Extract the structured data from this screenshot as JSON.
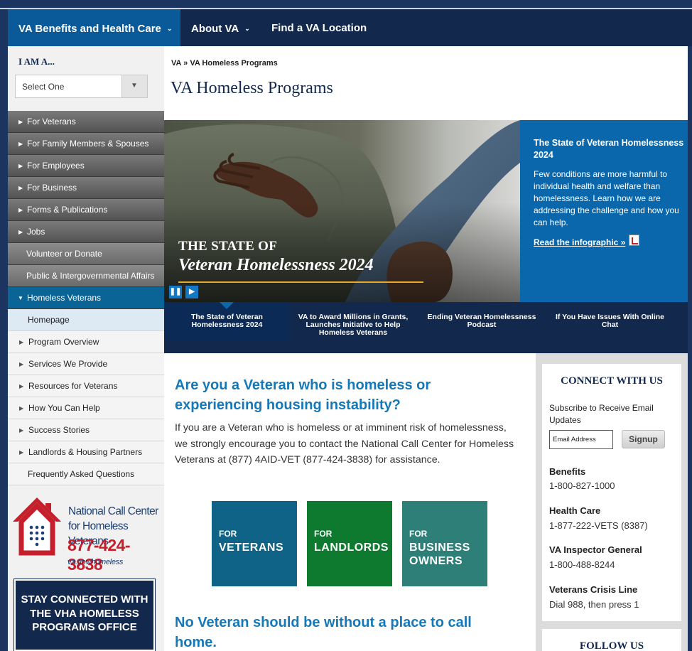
{
  "nav": {
    "items": [
      {
        "label": "VA Benefits and Health Care"
      },
      {
        "label": "About VA"
      },
      {
        "label": "Find a VA Location"
      }
    ]
  },
  "sidebar": {
    "iam_label": "I AM A...",
    "select_value": "Select One",
    "items": [
      {
        "label": "For Veterans"
      },
      {
        "label": "For Family Members & Spouses"
      },
      {
        "label": "For Employees"
      },
      {
        "label": "For Business"
      },
      {
        "label": "Forms & Publications"
      },
      {
        "label": "Jobs"
      },
      {
        "label": "Volunteer or Donate"
      },
      {
        "label": "Public & Intergovernmental Affairs"
      },
      {
        "label": "Homeless Veterans"
      }
    ],
    "subitems": [
      {
        "label": "Homepage"
      },
      {
        "label": "Program Overview"
      },
      {
        "label": "Services We Provide"
      },
      {
        "label": "Resources for Veterans"
      },
      {
        "label": "How You Can Help"
      },
      {
        "label": "Success Stories"
      },
      {
        "label": "Landlords & Housing Partners"
      },
      {
        "label": "Frequently Asked Questions"
      }
    ],
    "call_center": {
      "title_line1": "National Call Center",
      "title_line2": "for Homeless Veterans",
      "phone": "877-424-3838",
      "url": "va.gov/homeless"
    },
    "stay_connected": "STAY CONNECTED WITH THE VHA HOMELESS PROGRAMS OFFICE"
  },
  "breadcrumb": {
    "home": "VA",
    "sep": "»",
    "current": "VA Homeless Programs"
  },
  "page_title": "VA Homeless Programs",
  "hero": {
    "caption_line1": "THE STATE OF",
    "caption_line2": "Veteran Homelessness 2024",
    "pause_icon": "pause-icon",
    "play_icon": "play-icon"
  },
  "promo": {
    "title": "The State of Veteran Homelessness 2024",
    "body": "Few conditions are more harmful to individual health and welfare than homelessness. Learn how we are addressing the challenge and how you can help.",
    "link": "Read the infographic »"
  },
  "tabs": [
    {
      "label": "The State of Veteran Homelessness 2024"
    },
    {
      "label": "VA to Award Millions in Grants, Launches Initiative to Help Homeless Veterans"
    },
    {
      "label": "Ending Veteran Homelessness Podcast"
    },
    {
      "label": "If You Have Issues With Online Chat"
    }
  ],
  "main": {
    "question": "Are you a Veteran who is homeless or experiencing housing instability?",
    "paragraph": "If you are a Veteran who is homeless or at imminent risk of homelessness, we strongly encourage you to contact the National Call Center for Homeless Veterans at (877) 4AID-VET (877-424-3838) for assistance.",
    "tiles": [
      {
        "for": "FOR",
        "label": "VETERANS",
        "color": "#0f6387"
      },
      {
        "for": "FOR",
        "label": "LANDLORDS",
        "color": "#0e7a2f"
      },
      {
        "for": "FOR",
        "label": "BUSINESS OWNERS",
        "color": "#2e7f78"
      }
    ],
    "question2": "No Veteran should be without a place to call home."
  },
  "connect": {
    "title": "CONNECT WITH US",
    "subscribe_text": "Subscribe to Receive Email Updates",
    "email_placeholder": "Email Address",
    "signup": "Signup",
    "contacts": [
      {
        "name": "Benefits",
        "value": "1-800-827-1000"
      },
      {
        "name": "Health Care",
        "value": "1-877-222-VETS (8387)"
      },
      {
        "name": "VA Inspector General",
        "value": "1-800-488-8244"
      },
      {
        "name": "Veterans Crisis Line",
        "value": "Dial 988, then press 1"
      }
    ]
  },
  "follow": {
    "title": "FOLLOW US"
  }
}
